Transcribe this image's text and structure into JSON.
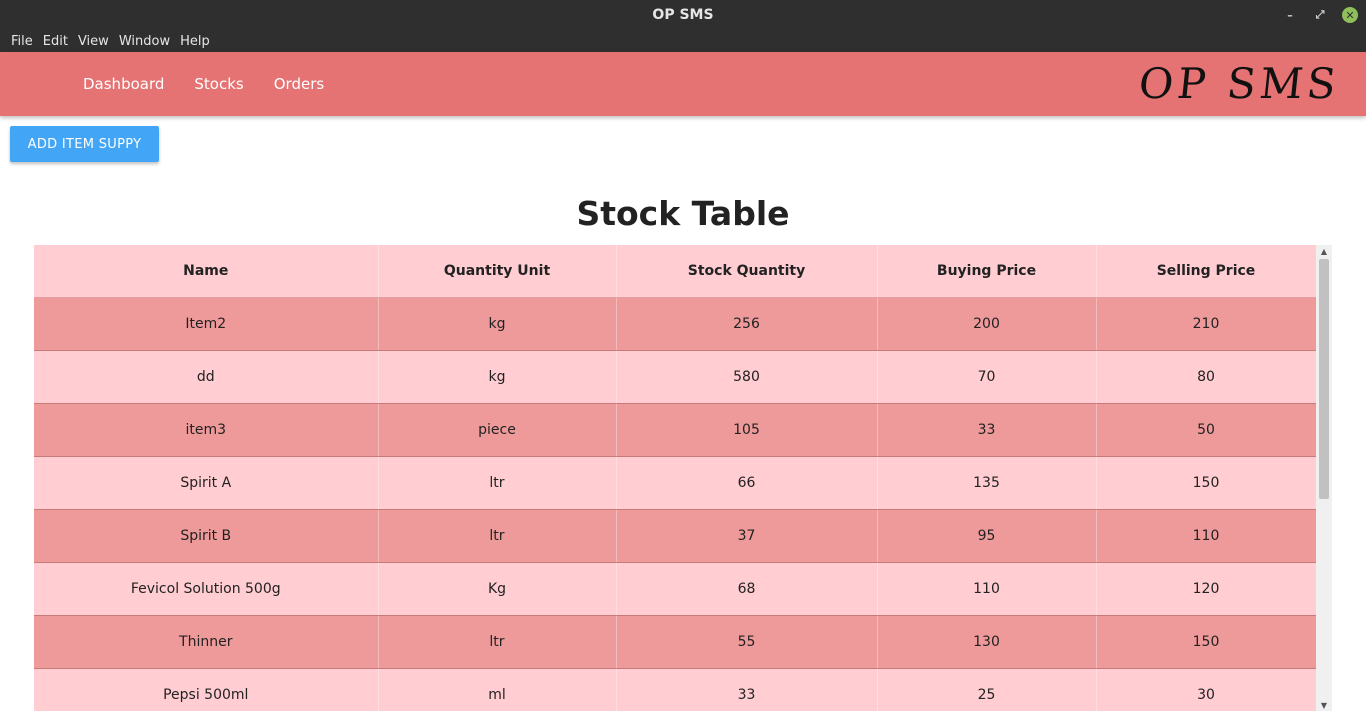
{
  "window": {
    "title": "OP SMS",
    "controls": {
      "minimize": "–",
      "restore": "⤢",
      "close": "✕"
    }
  },
  "menu": [
    "File",
    "Edit",
    "View",
    "Window",
    "Help"
  ],
  "navbar": {
    "links": [
      "Dashboard",
      "Stocks",
      "Orders"
    ],
    "brand": "OP SMS",
    "color": "#e57373"
  },
  "actions": {
    "add_button": "ADD ITEM SUPPY",
    "add_button_color": "#42a5f5"
  },
  "page": {
    "title": "Stock Table"
  },
  "table": {
    "columns": [
      "Name",
      "Quantity Unit",
      "Stock Quantity",
      "Buying Price",
      "Selling Price"
    ],
    "rows": [
      [
        "Item2",
        "kg",
        "256",
        "200",
        "210"
      ],
      [
        "dd",
        "kg",
        "580",
        "70",
        "80"
      ],
      [
        "item3",
        "piece",
        "105",
        "33",
        "50"
      ],
      [
        "Spirit A",
        "ltr",
        "66",
        "135",
        "150"
      ],
      [
        "Spirit B",
        "ltr",
        "37",
        "95",
        "110"
      ],
      [
        "Fevicol Solution 500g",
        "Kg",
        "68",
        "110",
        "120"
      ],
      [
        "Thinner",
        "ltr",
        "55",
        "130",
        "150"
      ],
      [
        "Pepsi 500ml",
        "ml",
        "33",
        "25",
        "30"
      ]
    ],
    "row_colors": {
      "dark": "#ef9a9a",
      "light": "#ffcdd2"
    }
  }
}
